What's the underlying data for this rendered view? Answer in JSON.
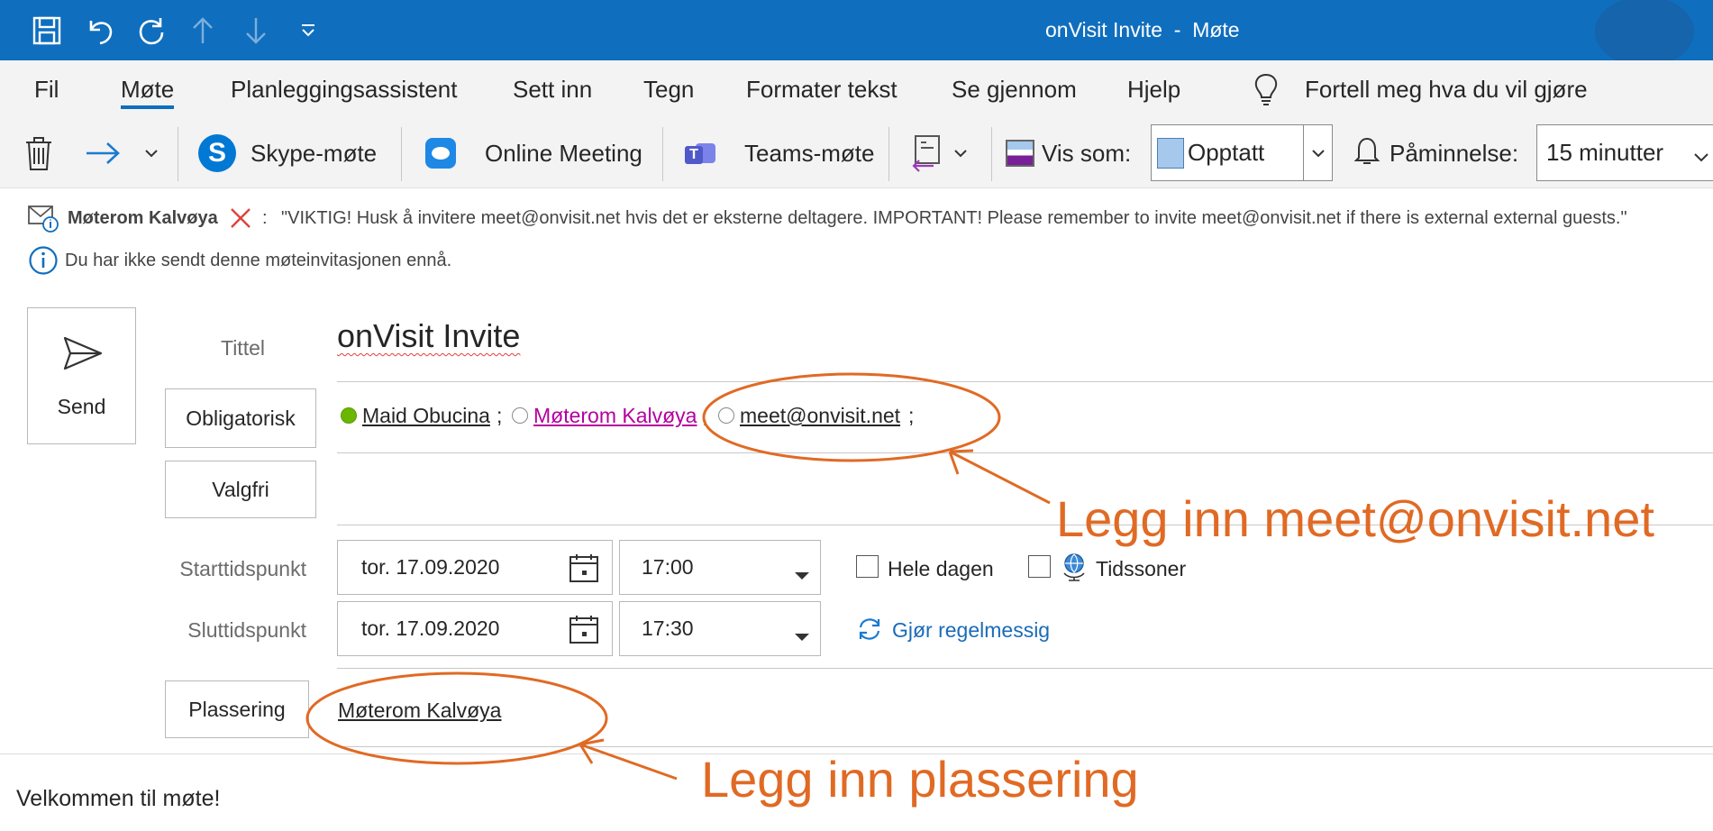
{
  "window": {
    "title": "onVisit Invite  -  Møte"
  },
  "qat": {
    "icons": [
      "save-icon",
      "undo-icon",
      "redo-icon",
      "arrow-up-icon",
      "arrow-down-icon",
      "customize-qat-icon"
    ]
  },
  "tabs": [
    {
      "label": "Fil",
      "active": false
    },
    {
      "label": "Møte",
      "active": true
    },
    {
      "label": "Planleggingsassistent",
      "active": false
    },
    {
      "label": "Sett inn",
      "active": false
    },
    {
      "label": "Tegn",
      "active": false
    },
    {
      "label": "Formater tekst",
      "active": false
    },
    {
      "label": "Se gjennom",
      "active": false
    },
    {
      "label": "Hjelp",
      "active": false
    }
  ],
  "tell_me": "Fortell meg hva du vil gjøre",
  "ribbon": {
    "skype": "Skype-møte",
    "online_meeting": "Online Meeting",
    "teams": "Teams-møte",
    "show_as_label": "Vis som:",
    "show_as_value": "Opptatt",
    "show_as_color": "#a5c8ec",
    "reminder_label": "Påminnelse:",
    "reminder_value": "15 minutter"
  },
  "infobar": {
    "room_name": "Møterom Kalvøya",
    "separator": ":",
    "room_message": "\"VIKTIG! Husk å invitere meet@onvisit.net hvis det er eksterne deltagere. IMPORTANT! Please remember to invite meet@onvisit.net if there is external external guests.\"",
    "not_sent": "Du har ikke sendt denne møteinvitasjonen ennå."
  },
  "form": {
    "send_label": "Send",
    "title_label": "Tittel",
    "title_value": "onVisit Invite",
    "required_button": "Obligatorisk",
    "optional_button": "Valgfri",
    "attendees": [
      {
        "name": "Maid Obucina",
        "suffix": ";",
        "status": "accepted",
        "color": "#262626"
      },
      {
        "name": "Møterom Kalvøya",
        "suffix": ";",
        "status": "unknown",
        "color": "#b4009e"
      },
      {
        "name": "meet@onvisit.net",
        "suffix": ";",
        "status": "unknown",
        "color": "#262626"
      }
    ],
    "start_label": "Starttidspunkt",
    "start_date": "tor. 17.09.2020",
    "start_time": "17:00",
    "end_label": "Sluttidspunkt",
    "end_date": "tor. 17.09.2020",
    "end_time": "17:30",
    "all_day": "Hele dagen",
    "time_zones": "Tidssoner",
    "recurrence": "Gjør regelmessig",
    "location_button": "Plassering",
    "location_value": "Møterom Kalvøya"
  },
  "body_text": "Velkommen til møte!",
  "annotations": {
    "add_email": "Legg inn meet@onvisit.net",
    "add_location": "Legg inn plassering",
    "color": "#e06a24"
  }
}
